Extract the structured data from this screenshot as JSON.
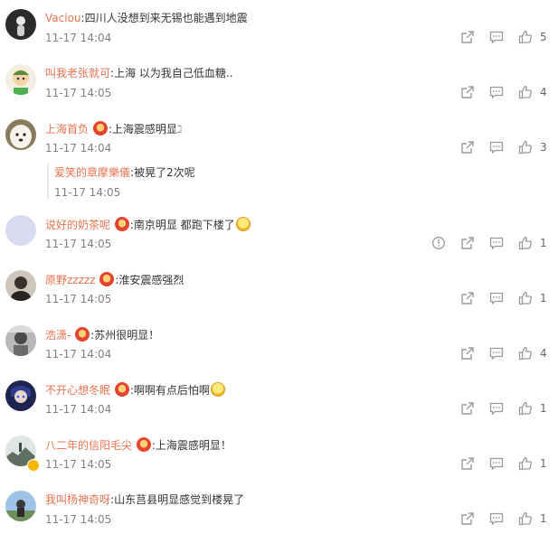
{
  "colors": {
    "username": "#eb7350",
    "text": "#333333",
    "time": "#808080",
    "icon": "#999999"
  },
  "comments": [
    {
      "user": "Vaciou",
      "text": "四川人没想到来无锡也能遇到地震",
      "time": "11-17 14:04",
      "likes": "5",
      "avatar": "dark-figure-avatar"
    },
    {
      "user": "叫我老张就可",
      "text": "上海 以为我自己低血糖..",
      "time": "11-17 14:05",
      "likes": "4",
      "avatar": "cartoon-avatar"
    },
    {
      "user": "上海首负",
      "text": "上海震感明显",
      "time": "11-17 14:04",
      "likes": "3",
      "avatar": "dog-avatar",
      "reply": {
        "user": "爱笑的章摩樂儀",
        "text": "被晃了2次呢",
        "time": "11-17 14:05"
      }
    },
    {
      "user": "说好的奶茶呢",
      "text": "南京明显 都跑下楼了",
      "time": "11-17 14:05",
      "likes": "1",
      "avatar": "blank-avatar"
    },
    {
      "user": "原野zzzzz",
      "text": "淮安震感强烈",
      "time": "11-17 14:05",
      "likes": "1",
      "avatar": "person-avatar"
    },
    {
      "user": "浩潇-",
      "text": "苏州很明显！",
      "time": "11-17 14:04",
      "likes": "4",
      "avatar": "photo-avatar"
    },
    {
      "user": "不开心想冬眠",
      "text": "啊啊有点后怕啊",
      "time": "11-17 14:04",
      "likes": "1",
      "avatar": "anime-avatar"
    },
    {
      "user": "八二年的信阳毛尖",
      "text": "上海震感明显！",
      "time": "11-17 14:05",
      "likes": "1",
      "avatar": "landscape-avatar"
    },
    {
      "user": "我叫杨神奇呀",
      "text": "山东莒县明显感觉到楼晃了",
      "time": "11-17 14:05",
      "likes": "1",
      "avatar": "outdoor-avatar"
    }
  ]
}
